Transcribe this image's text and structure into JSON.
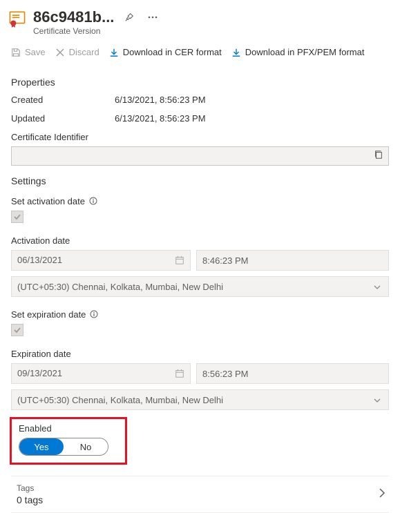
{
  "header": {
    "title": "86c9481b...",
    "subtitle": "Certificate Version"
  },
  "toolbar": {
    "save": "Save",
    "discard": "Discard",
    "download_cer": "Download in CER format",
    "download_pfx": "Download in PFX/PEM format"
  },
  "properties": {
    "heading": "Properties",
    "created_label": "Created",
    "created_value": "6/13/2021, 8:56:23 PM",
    "updated_label": "Updated",
    "updated_value": "6/13/2021, 8:56:23 PM",
    "cert_id_label": "Certificate Identifier",
    "cert_id_value": ""
  },
  "settings": {
    "heading": "Settings",
    "activation_label": "Set activation date",
    "activation_date_heading": "Activation date",
    "activation_date": "06/13/2021",
    "activation_time": "8:46:23 PM",
    "activation_tz": "(UTC+05:30) Chennai, Kolkata, Mumbai, New Delhi",
    "expiration_label": "Set expiration date",
    "expiration_date_heading": "Expiration date",
    "expiration_date": "09/13/2021",
    "expiration_time": "8:56:23 PM",
    "expiration_tz": "(UTC+05:30) Chennai, Kolkata, Mumbai, New Delhi",
    "enabled_label": "Enabled",
    "enabled_yes": "Yes",
    "enabled_no": "No"
  },
  "tags": {
    "label": "Tags",
    "count": "0 tags"
  }
}
